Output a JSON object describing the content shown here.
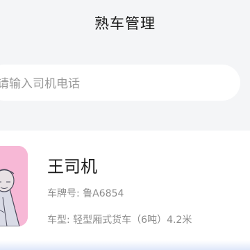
{
  "header": {
    "title": "熟车管理"
  },
  "search": {
    "placeholder": "请输入司机电话"
  },
  "drivers": [
    {
      "name": "王司机",
      "plate_label": "车牌号:",
      "plate": "鲁A6854",
      "type_label": "车型:",
      "vehicle_type": "轻型厢式货车（6吨）4.2米"
    }
  ],
  "colors": {
    "avatar_bg": "#f7b8d6",
    "page_bg": "#f4f5f7"
  }
}
